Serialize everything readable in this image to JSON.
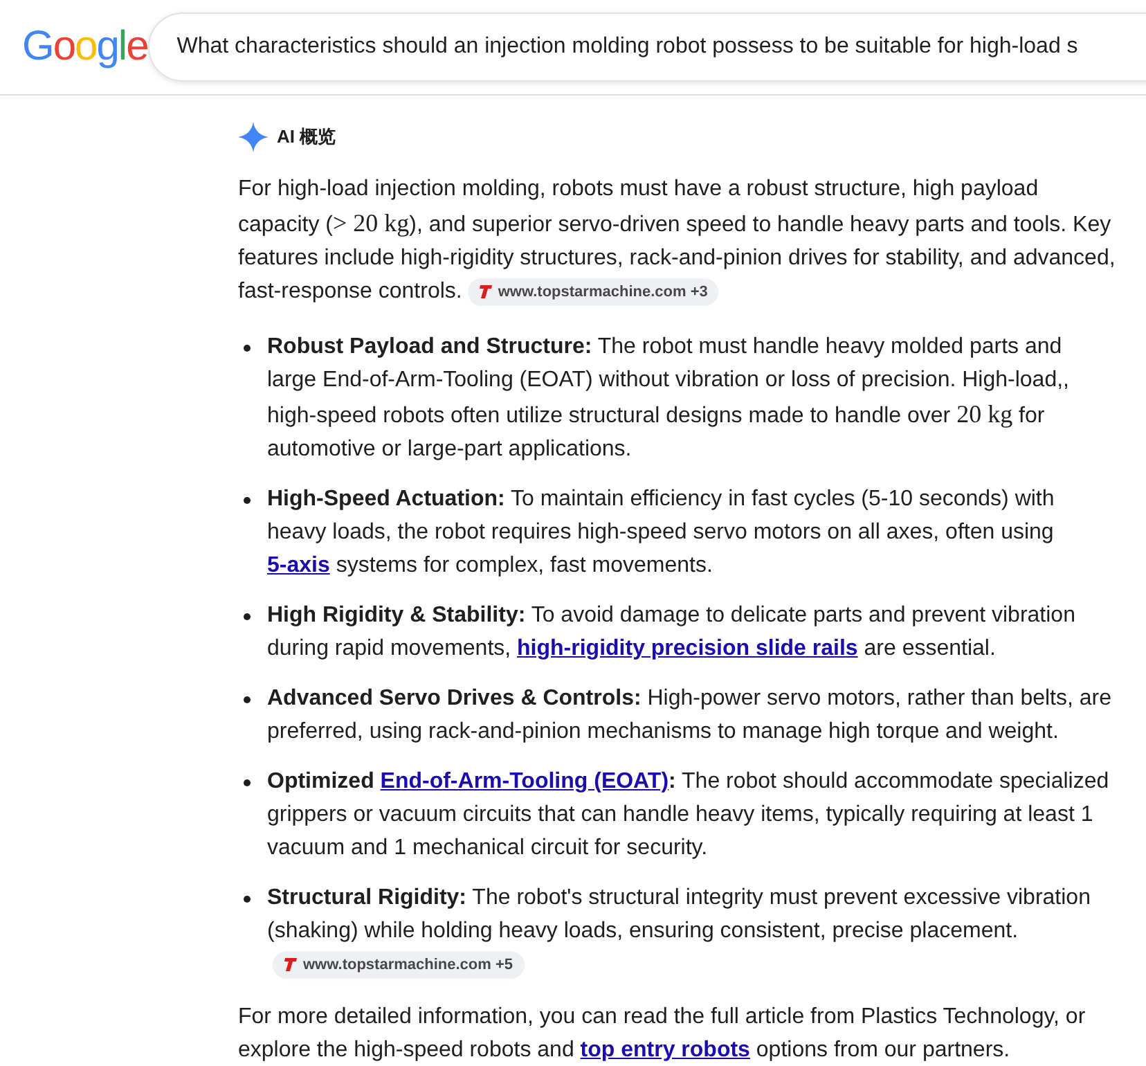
{
  "logo": "Google",
  "search": {
    "value": "What characteristics should an injection molding robot possess to be suitable for high-load s"
  },
  "overview": {
    "label": "AI 概览"
  },
  "intro": {
    "segments": [
      {
        "kind": "text",
        "text": "For high-load injection molding, robots must have a robust structure, high payload capacity ("
      },
      {
        "kind": "math",
        "text": "> 20 kg"
      },
      {
        "kind": "text",
        "text": "), and superior servo-driven speed to handle heavy parts and tools. Key features include high-rigidity structures, rack-and-pinion drives for stability, and advanced, fast-response controls."
      }
    ],
    "source": "www.topstarmachine.com +3"
  },
  "bullets": [
    {
      "segments": [
        {
          "kind": "bold",
          "text": "Robust Payload and Structure:"
        },
        {
          "kind": "text",
          "text": " The robot must handle heavy molded parts and large End-of-Arm-Tooling (EOAT) without vibration or loss of precision. High-load,, high-speed robots often utilize structural designs made to handle over "
        },
        {
          "kind": "math",
          "text": "20 kg"
        },
        {
          "kind": "text",
          "text": " for automotive or large-part applications."
        }
      ]
    },
    {
      "segments": [
        {
          "kind": "bold",
          "text": "High-Speed Actuation:"
        },
        {
          "kind": "text",
          "text": " To maintain efficiency in fast cycles (5-10 seconds) with heavy loads, the robot requires high-speed servo motors on all axes, often using "
        },
        {
          "kind": "link",
          "text": "5-axis"
        },
        {
          "kind": "text",
          "text": " systems for complex, fast movements."
        }
      ]
    },
    {
      "segments": [
        {
          "kind": "bold",
          "text": "High Rigidity & Stability:"
        },
        {
          "kind": "text",
          "text": " To avoid damage to delicate parts and prevent vibration during rapid movements, "
        },
        {
          "kind": "link",
          "text": "high-rigidity precision slide rails"
        },
        {
          "kind": "text",
          "text": " are essential."
        }
      ]
    },
    {
      "segments": [
        {
          "kind": "bold",
          "text": "Advanced Servo Drives & Controls:"
        },
        {
          "kind": "text",
          "text": " High-power servo motors, rather than belts, are preferred, using rack-and-pinion mechanisms to manage high torque and weight."
        }
      ]
    },
    {
      "segments": [
        {
          "kind": "bold",
          "text": "Optimized "
        },
        {
          "kind": "link",
          "text": "End-of-Arm-Tooling (EOAT)"
        },
        {
          "kind": "bold",
          "text": ":"
        },
        {
          "kind": "text",
          "text": " The robot should accommodate specialized grippers or vacuum circuits that can handle heavy items, typically requiring at least 1 vacuum and 1 mechanical circuit for security."
        }
      ]
    },
    {
      "segments": [
        {
          "kind": "bold",
          "text": "Structural Rigidity:"
        },
        {
          "kind": "text",
          "text": " The robot's structural integrity must prevent excessive vibration (shaking) while holding heavy loads, ensuring consistent, precise placement."
        }
      ],
      "source": "www.topstarmachine.com +5"
    }
  ],
  "outro": {
    "segments": [
      {
        "kind": "text",
        "text": "For more detailed information, you can read the full article from Plastics Technology, or explore the high-speed robots and "
      },
      {
        "kind": "link",
        "text": "top entry robots"
      },
      {
        "kind": "text",
        "text": " options from our partners."
      }
    ]
  }
}
